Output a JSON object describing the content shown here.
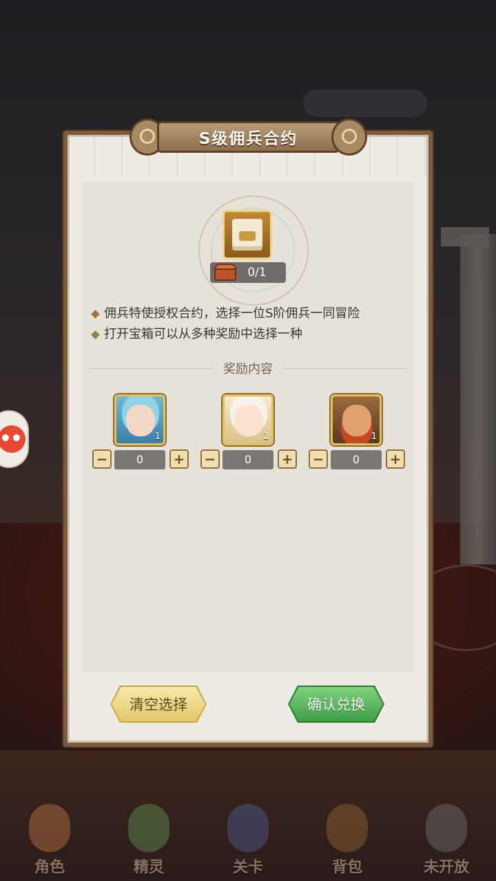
{
  "dialog": {
    "title": "S级佣兵合约",
    "item_count": "0/1",
    "description": [
      "佣兵特使授权合约，选择一位S阶佣兵一同冒险",
      "打开宝箱可以从多种奖励中选择一种"
    ],
    "reward_header": "奖励内容",
    "rewards": [
      {
        "qty_badge": "1",
        "selected": "0",
        "minus": "−",
        "plus": "+"
      },
      {
        "qty_badge": "1",
        "selected": "0",
        "minus": "−",
        "plus": "+"
      },
      {
        "qty_badge": "1",
        "selected": "0",
        "minus": "−",
        "plus": "+"
      }
    ],
    "clear_button": "清空选择",
    "confirm_button": "确认兑换"
  },
  "bottom_nav": [
    {
      "label": "角色"
    },
    {
      "label": "精灵"
    },
    {
      "label": "关卡"
    },
    {
      "label": "背包"
    },
    {
      "label": "未开放"
    }
  ]
}
